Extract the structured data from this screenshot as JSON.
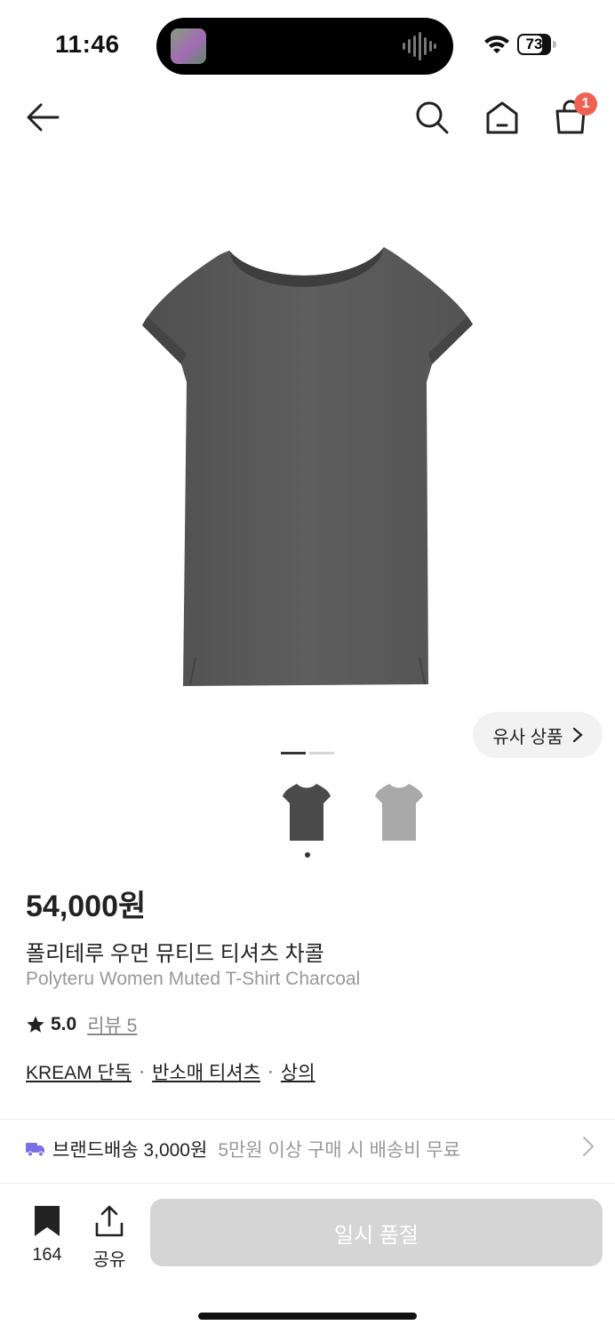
{
  "status_bar": {
    "time": "11:46",
    "battery": "73"
  },
  "nav": {
    "cart_count": "1"
  },
  "product": {
    "similar_label": "유사 상품",
    "price": "54,000원",
    "name_ko": "폴리테루 우먼 뮤티드 티셔츠 차콜",
    "name_en": "Polyteru Women Muted T-Shirt Charcoal",
    "rating": "5.0",
    "review_label": "리뷰 5",
    "tags": [
      "KREAM 단독",
      "반소매 티셔츠",
      "상의"
    ],
    "tag_separator": "·",
    "image_pager": {
      "total": 2,
      "active": 0
    },
    "color_options": [
      {
        "color": "#4a4a4a"
      },
      {
        "color": "#a9a9a9"
      }
    ],
    "selected_option": 0
  },
  "shipping": {
    "main": "브랜드배송 3,000원",
    "sub": "5만원 이상 구매 시 배송비 무료"
  },
  "bottom_bar": {
    "bookmark_count": "164",
    "share_label": "공유",
    "soldout_label": "일시 품절"
  },
  "colors": {
    "badge": "#ef6253",
    "truck_icon": "#7b6fe6",
    "shirt_main": "#5a5a5a",
    "soldout_bg": "#d5d5d5"
  }
}
